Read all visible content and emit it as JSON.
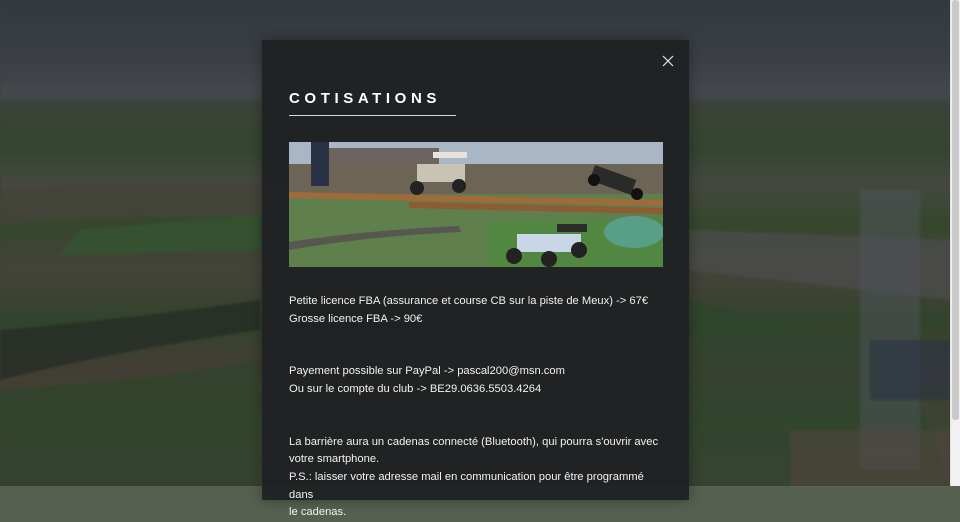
{
  "modal": {
    "title": "COTISATIONS",
    "close_icon": "close-icon",
    "paragraphs": {
      "licence_small": "Petite licence FBA (assurance et course CB sur la piste de Meux) -> 67€",
      "licence_large": "Grosse licence FBA -> 90€",
      "payment_paypal": "Payement possible sur PayPal -> pascal200@msn.com",
      "payment_account": "Ou sur le compte du club -> BE29.0636.5503.4264",
      "barrier_1": "La barrière aura un cadenas connecté (Bluetooth), qui pourra s'ouvrir avec",
      "barrier_2": "votre smartphone.",
      "ps_1": "P.S.: laisser votre adresse mail en communication pour être programmé dans",
      "ps_2": "le cadenas."
    }
  }
}
